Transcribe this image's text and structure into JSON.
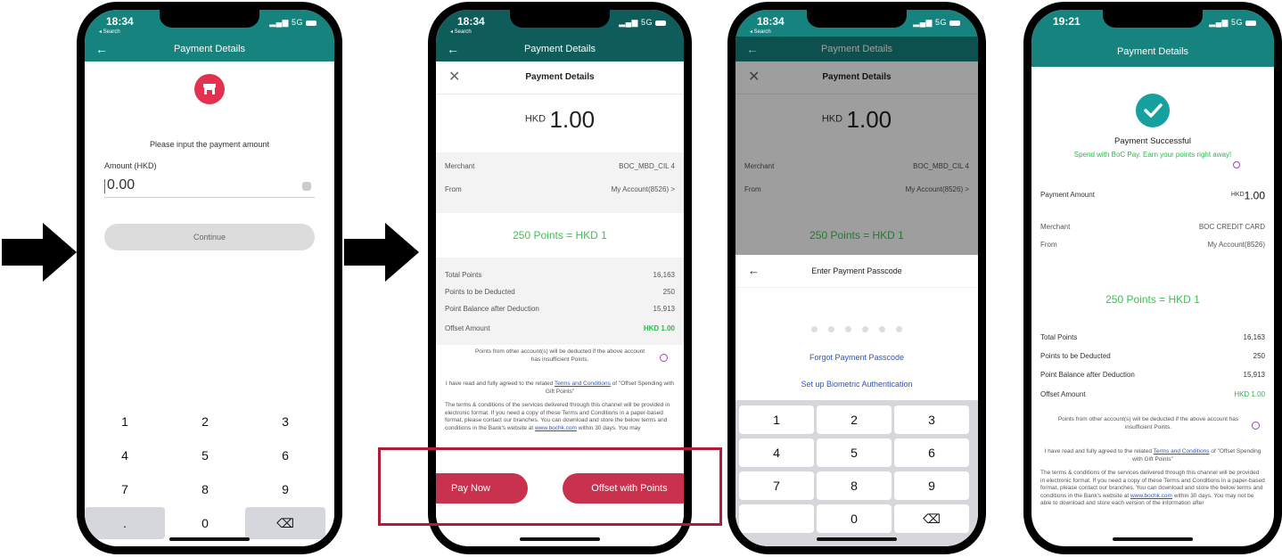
{
  "colors": {
    "teal": "#16837e",
    "primary_red": "#c8324f",
    "points_green": "#3fbf54",
    "highlight": "#b01b3a"
  },
  "screen1": {
    "time": "18:34",
    "back_nav": "◂ Search",
    "signal": "5G",
    "title": "Payment Details",
    "shop_icon": "store-icon",
    "prompt": "Please input the payment amount",
    "amount_label": "Amount (HKD)",
    "amount_value": "0.00",
    "continue_label": "Continue",
    "keys": [
      "1",
      "2",
      "3",
      "4",
      "5",
      "6",
      "7",
      "8",
      "9",
      ".",
      "0",
      "⌫"
    ]
  },
  "screen2": {
    "time": "18:34",
    "back_nav": "◂ Search",
    "signal": "5G",
    "title": "Payment Details",
    "sheet_title": "Payment Details",
    "currency": "HKD",
    "amount": "1.00",
    "merchant_label": "Merchant",
    "merchant_value": "BOC_MBD_CIL 4",
    "from_label": "From",
    "from_value": "My Account(8526) >",
    "points_rate": "250 Points = HKD 1",
    "total_points_label": "Total Points",
    "total_points_value": "16,163",
    "deducted_label": "Points to be Deducted",
    "deducted_value": "250",
    "balance_label": "Point Balance after Deduction",
    "balance_value": "15,913",
    "offset_label": "Offset Amount",
    "offset_value": "HKD 1.00",
    "note": "Points from other account(s) will be deducted if the above account has insufficient Points.",
    "agree_text": "I have read and fully agreed to the related",
    "terms_link": "Terms and Conditions",
    "terms_suffix": "of \"Offset Spending with Gift Points\"",
    "terms_body": "The terms & conditions of the services delivered through this channel will be provided in electronic format. If you need a copy of these Terms and Conditions in a paper-based format, please contact our branches. You can download and store the below terms and conditions in the Bank's website at",
    "terms_site": "www.bochk.com",
    "terms_tail": "within 30 days. You may",
    "pay_now": "Pay Now",
    "offset_points": "Offset with Points"
  },
  "screen3": {
    "time": "18:34",
    "back_nav": "◂ Search",
    "signal": "5G",
    "title": "Payment Details",
    "sheet_title": "Payment Details",
    "currency": "HKD",
    "amount": "1.00",
    "merchant_label": "Merchant",
    "merchant_value": "BOC_MBD_CIL 4",
    "from_label": "From",
    "from_value": "My Account(8526) >",
    "points_rate": "250 Points = HKD 1",
    "passcode_title": "Enter Payment Passcode",
    "forgot": "Forgot Payment Passcode",
    "biometric": "Set up Biometric Authentication",
    "keys": [
      "1",
      "2",
      "3",
      "4",
      "5",
      "6",
      "7",
      "8",
      "9",
      "",
      "0",
      "⌫"
    ]
  },
  "screen4": {
    "time": "19:21",
    "signal": "5G",
    "title": "Payment Details",
    "success": "Payment Successful",
    "promo": "Spend with BoC Pay. Earn your points right away!",
    "payment_amount_label": "Payment Amount",
    "payment_amount_cur": "HKD",
    "payment_amount_value": "1.00",
    "merchant_label": "Merchant",
    "merchant_value": "BOC CREDIT CARD",
    "from_label": "From",
    "from_value": "My Account(8526)",
    "points_rate": "250 Points = HKD 1",
    "total_points_label": "Total Points",
    "total_points_value": "16,163",
    "deducted_label": "Points to be Deducted",
    "deducted_value": "250",
    "balance_label": "Point Balance after Deduction",
    "balance_value": "15,913",
    "offset_label": "Offset Amount",
    "offset_value": "HKD 1.00",
    "note": "Points from other account(s) will be deducted if the above account has insufficient Points.",
    "agree_text": "I have read and fully agreed to the related",
    "terms_link": "Terms and Conditions",
    "terms_suffix": "of \"Offset Spending with Gift Points\"",
    "terms_body": "The terms & conditions of the services delivered through this channel will be provided in electronic format. If you need a copy of these Terms and Conditions in a paper-based format, please contact our branches. You can download and store the below terms and conditions in the Bank's website at",
    "terms_site": "www.bochk.com",
    "terms_tail": "within 30 days. You may not be able to download and store each version of the information after"
  }
}
